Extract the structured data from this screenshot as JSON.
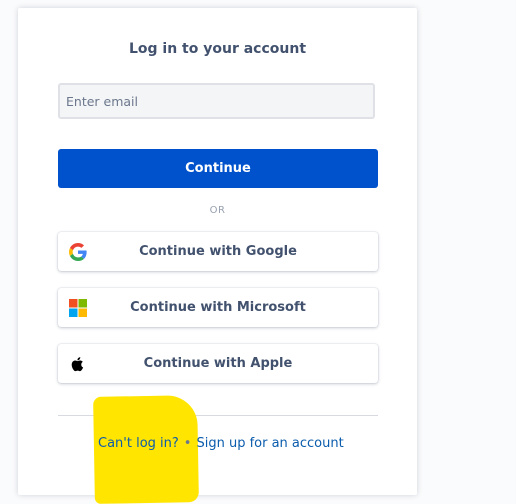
{
  "login": {
    "title": "Log in to your account",
    "email_placeholder": "Enter email",
    "email_value": "",
    "continue_label": "Continue",
    "divider_text": "OR"
  },
  "social_buttons": [
    {
      "label": "Continue with Google",
      "icon": "google-icon"
    },
    {
      "label": "Continue with Microsoft",
      "icon": "microsoft-icon"
    },
    {
      "label": "Continue with Apple",
      "icon": "apple-icon"
    }
  ],
  "footer": {
    "cant_login": "Can't log in?",
    "separator": "•",
    "signup": "Sign up for an account"
  },
  "colors": {
    "primary": "#0052cc",
    "highlight": "#ffe500",
    "text": "#42526e"
  }
}
